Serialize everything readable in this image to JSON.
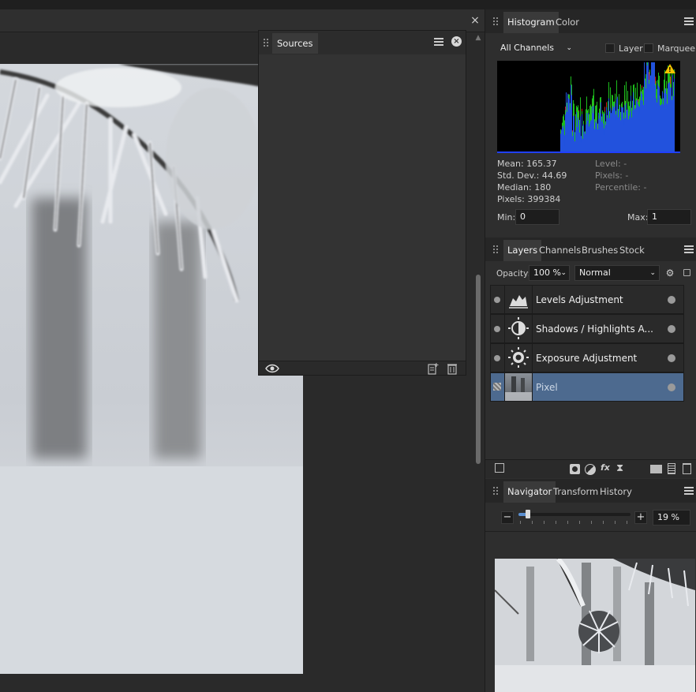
{
  "document": {
    "close_glyph": "×"
  },
  "sources": {
    "tab_label": "Sources"
  },
  "histogram_panel": {
    "tabs": [
      "Histogram",
      "Color"
    ],
    "channel_select": "All Channels",
    "layer_label": "Layer",
    "marquee_label": "Marquee",
    "warning_glyph": "!",
    "stats_left": [
      "Mean: 165.37",
      "Std. Dev.: 44.69",
      "Median: 180",
      "Pixels: 399384"
    ],
    "stats_right": [
      "Level: -",
      "Pixels: -",
      "Percentile: -"
    ],
    "min_label": "Min:",
    "min_value": "0",
    "max_label": "Max:",
    "max_value": "1"
  },
  "layers_panel": {
    "tabs": [
      "Layers",
      "Channels",
      "Brushes",
      "Stock"
    ],
    "opacity_label": "Opacity:",
    "opacity_value": "100 %",
    "blend_mode": "Normal",
    "layers": [
      {
        "name": "Levels Adjustment",
        "icon": "levels-icon",
        "selected": false
      },
      {
        "name": "Shadows / Highlights A...",
        "icon": "shadows-highlights-icon",
        "selected": false
      },
      {
        "name": "Exposure Adjustment",
        "icon": "exposure-icon",
        "selected": false
      },
      {
        "name": "Pixel",
        "icon": "pixel-thumbnail",
        "selected": true
      }
    ]
  },
  "navigator_panel": {
    "tabs": [
      "Navigator",
      "Transform",
      "History"
    ],
    "zoom_value": "19 %",
    "zoom_minus": "−",
    "zoom_plus": "+"
  },
  "colors": {
    "selection": "#4d6a8f",
    "panel_bg": "#2e2e2e",
    "histogram_red": "#e02020",
    "histogram_green": "#20d020",
    "histogram_blue": "#2040ff",
    "warning": "#f5c400"
  }
}
